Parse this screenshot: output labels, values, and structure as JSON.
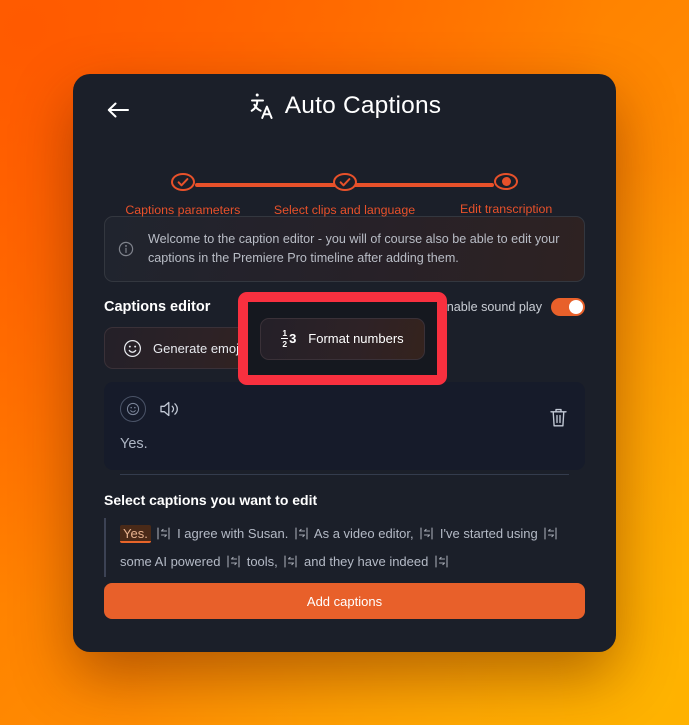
{
  "background": {
    "color_start": "#ff6a00",
    "color_end": "#ffa40a"
  },
  "modal": {
    "header": {
      "back_icon": "arrow-left-icon",
      "title_icon": "translate-icon",
      "title": "Auto Captions"
    },
    "stepper": {
      "steps": [
        {
          "label": "Captions parameters",
          "state": "complete"
        },
        {
          "label": "Select clips and language",
          "state": "complete"
        },
        {
          "label": "Edit transcription",
          "state": "current"
        }
      ],
      "accent": "#e8512a"
    },
    "banner": {
      "icon": "info-icon",
      "text": "Welcome to the caption editor - you will of course also be able to edit your captions in the Premiere Pro timeline after adding them."
    },
    "editor": {
      "section_title": "Captions editor",
      "sound_toggle_label": "Enable sound play",
      "sound_toggle_on": true,
      "tools": [
        {
          "icon": "smiley-icon",
          "label": "Generate emojis"
        },
        {
          "icon": "format-numbers-icon",
          "label": "Format numbers"
        }
      ]
    },
    "caption_card": {
      "emoji_icon": "smiley-circle-icon",
      "speaker_icon": "speaker-icon",
      "delete_icon": "trash-icon",
      "text": "Yes."
    },
    "select_section": {
      "title": "Select captions you want to edit",
      "segments": [
        "Yes.",
        "I agree with Susan.",
        "As a video editor,",
        "I've started using",
        "some AI powered",
        "tools,",
        "and they have indeed"
      ],
      "highlighted_segment": "Yes.",
      "break_icon": "line-break-icon"
    },
    "ghost_segments": [
      "Yes.",
      "I agree with Susan.",
      "As a video editor,",
      "I've started using"
    ],
    "add_button": {
      "label": "Add captions",
      "color": "#e8602a"
    }
  },
  "highlight": {
    "target": "Format numbers",
    "icon": "format-numbers-icon",
    "border_color": "#f8303f"
  }
}
